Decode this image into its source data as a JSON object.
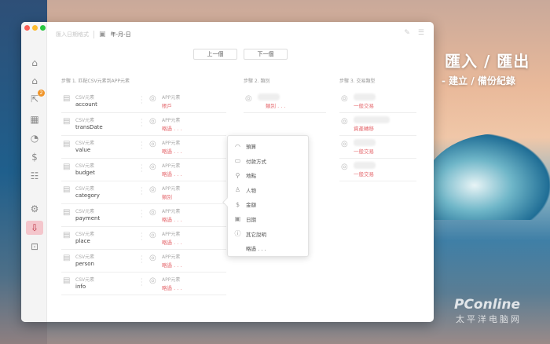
{
  "promo": {
    "title": "匯入 / 匯出",
    "subtitle": "- 建立 / 備份紀錄"
  },
  "watermark": {
    "brand": "PConline",
    "sub": "太平洋电脑网"
  },
  "header": {
    "breadcrumb": "匯入日期格式",
    "date_format": "年-月-日"
  },
  "nav": {
    "prev": "上一個",
    "next": "下一個"
  },
  "sidebar": {
    "badge": "2",
    "items": [
      "home-icon",
      "house-settings-icon",
      "export-icon",
      "qr-icon",
      "timer-icon",
      "money-bag-icon",
      "list-icon",
      "gear-icon",
      "import-icon",
      "lock-icon"
    ]
  },
  "step1": {
    "label": "步驟 1. 匹配CSV元素到APP元素",
    "csv_label": "CSV元素",
    "app_label": "APP元素",
    "rows": [
      {
        "csv": "account",
        "app": "賬戶"
      },
      {
        "csv": "transDate",
        "app": "略過 . . ."
      },
      {
        "csv": "value",
        "app": "略過 . . ."
      },
      {
        "csv": "budget",
        "app": "略過 . . ."
      },
      {
        "csv": "category",
        "app": "類別"
      },
      {
        "csv": "payment",
        "app": "略過 . . ."
      },
      {
        "csv": "place",
        "app": "略過 . . ."
      },
      {
        "csv": "person",
        "app": "略過 . . ."
      },
      {
        "csv": "info",
        "app": "略過 . . ."
      }
    ]
  },
  "step2": {
    "label": "步驟 2. 類別",
    "rows": [
      {
        "value": "類別 . . ."
      }
    ]
  },
  "step3": {
    "label": "步驟 3. 交易類型",
    "rows": [
      {
        "value": "一般交易"
      },
      {
        "value": "資產轉移"
      },
      {
        "value": "一般交易"
      },
      {
        "value": "一般交易"
      }
    ]
  },
  "popup": {
    "items": [
      {
        "icon": "budget-icon",
        "label": "預算"
      },
      {
        "icon": "card-icon",
        "label": "付款方式"
      },
      {
        "icon": "pin-icon",
        "label": "地點"
      },
      {
        "icon": "person-icon",
        "label": "人物"
      },
      {
        "icon": "money-icon",
        "label": "金額"
      },
      {
        "icon": "calendar-icon",
        "label": "日期"
      },
      {
        "icon": "info-icon",
        "label": "其它說明"
      },
      {
        "icon": "",
        "label": "略過 . . ."
      }
    ]
  }
}
